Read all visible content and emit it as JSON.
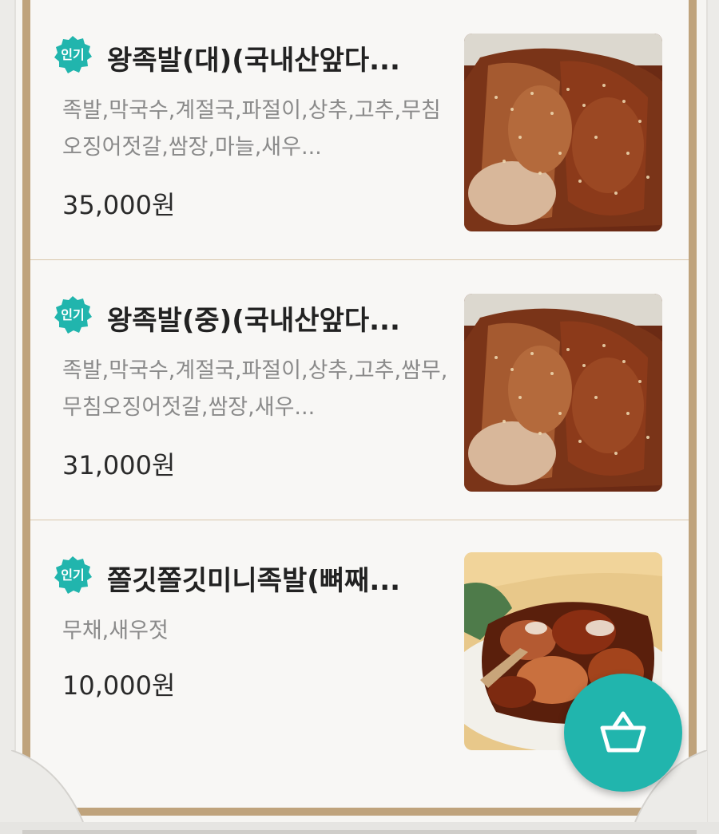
{
  "menu_items": [
    {
      "badge": "인기",
      "title": "왕족발(대)(국내산앞다...",
      "description": "족발,막국수,계절국,파절이,상추,고추,무침오징어젓갈,쌈장,마늘,새우...",
      "price": "35,000원",
      "image": "jokbal-sliced-photo"
    },
    {
      "badge": "인기",
      "title": "왕족발(중)(국내산앞다...",
      "description": "족발,막국수,계절국,파절이,상추,고추,쌈무,무침오징어젓갈,쌈장,새우...",
      "price": "31,000원",
      "image": "jokbal-sliced-photo"
    },
    {
      "badge": "인기",
      "title": "쫄깃쫄깃미니족발(뼈째...",
      "description": "무채,새우젓",
      "price": "10,000원",
      "image": "mini-jokbal-photo"
    }
  ],
  "colors": {
    "accent": "#21b5ad",
    "frame": "#bfa37c",
    "divider": "#d9c7ab"
  },
  "fab": {
    "icon": "shopping-basket-icon"
  }
}
